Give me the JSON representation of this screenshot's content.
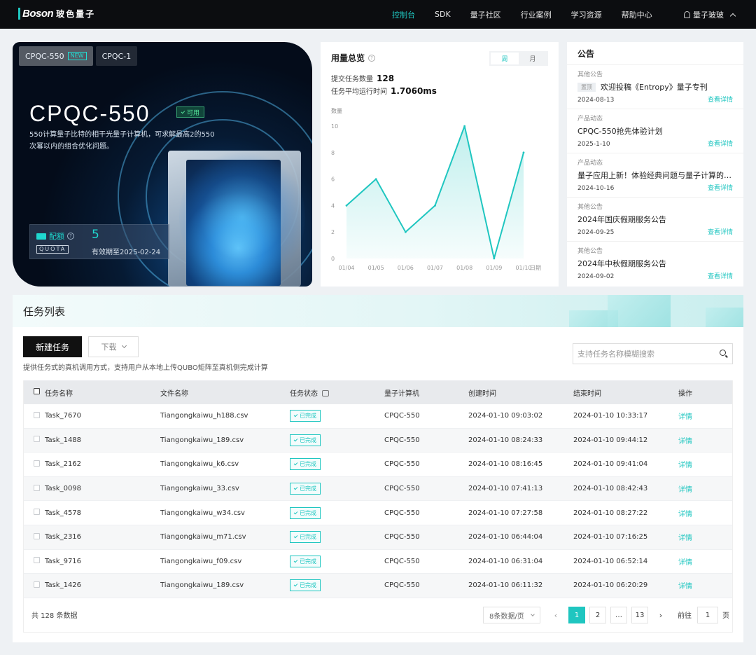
{
  "nav": {
    "logo_mark": "Boson",
    "logo_cn": "玻色量子",
    "items": [
      "控制台",
      "SDK",
      "量子社区",
      "行业案例",
      "学习资源",
      "帮助中心"
    ],
    "user": "量子玻玻"
  },
  "hero": {
    "tabs": [
      "CPQC-550",
      "CPQC-1"
    ],
    "new_tag": "NEW",
    "title": "CPQC-550",
    "badge": "可用",
    "desc": "550计算量子比特的相干光量子计算机，可求解最高2的550次幂以内的组合优化问题。",
    "quota_label": "配额",
    "quota_sub": "QUOTA",
    "quota_value": "5",
    "quota_expire": "有效期至2025-02-24"
  },
  "usage": {
    "title": "用量总览",
    "toggle": [
      "周",
      "月"
    ],
    "submit_label": "提交任务数量",
    "submit_value": "128",
    "avg_label": "任务平均运行时间",
    "avg_value": "1.7060ms"
  },
  "chart_data": {
    "type": "area",
    "title": "",
    "ylabel": "数量",
    "xlabel": "日期",
    "categories": [
      "01/04",
      "01/05",
      "01/06",
      "01/07",
      "01/08",
      "01/09",
      "01/10"
    ],
    "values": [
      4,
      6,
      2,
      4,
      10,
      0,
      8
    ],
    "yticks": [
      "0",
      "2",
      "4",
      "6",
      "8",
      "10"
    ],
    "ylim": [
      0,
      10
    ],
    "grid": false,
    "color": "#1fc6c0"
  },
  "notice": {
    "title": "公告",
    "pin_tag": "置顶",
    "link_label": "查看详情",
    "items": [
      {
        "category": "其他公告",
        "title": "欢迎投稿《Entropy》量子专刊",
        "date": "2024-08-13"
      },
      {
        "category": "产品动态",
        "title": "CPQC-550抢先体验计划",
        "date": "2025-1-10"
      },
      {
        "category": "产品动态",
        "title": "量子应用上新！体验经典问题与量子计算的…",
        "date": "2024-10-16"
      },
      {
        "category": "其他公告",
        "title": "2024年国庆假期服务公告",
        "date": "2024-09-25"
      },
      {
        "category": "其他公告",
        "title": "2024年中秋假期服务公告",
        "date": "2024-09-02"
      }
    ]
  },
  "tasks": {
    "title": "任务列表",
    "new_button": "新建任务",
    "download_button": "下载",
    "hint": "提供任务式的真机调用方式，支持用户从本地上传QUBO矩阵至真机侧完成计算",
    "search_placeholder": "支持任务名称模糊搜索",
    "columns": [
      "任务名称",
      "文件名称",
      "任务状态",
      "量子计算机",
      "创建时间",
      "结束时间",
      "操作"
    ],
    "status_label": "已完成",
    "action_label": "详情",
    "rows": [
      {
        "name": "Task_7670",
        "file": "Tiangongkaiwu_h188.csv",
        "machine": "CPQC-550",
        "created": "2024-01-10 09:03:02",
        "ended": "2024-01-10 10:33:17"
      },
      {
        "name": "Task_1488",
        "file": "Tiangongkaiwu_189.csv",
        "machine": "CPQC-550",
        "created": "2024-01-10 08:24:33",
        "ended": "2024-01-10 09:44:12"
      },
      {
        "name": "Task_2162",
        "file": "Tiangongkaiwu_k6.csv",
        "machine": "CPQC-550",
        "created": "2024-01-10 08:16:45",
        "ended": "2024-01-10 09:41:04"
      },
      {
        "name": "Task_0098",
        "file": "Tiangongkaiwu_33.csv",
        "machine": "CPQC-550",
        "created": "2024-01-10 07:41:13",
        "ended": "2024-01-10 08:42:43"
      },
      {
        "name": "Task_4578",
        "file": "Tiangongkaiwu_w34.csv",
        "machine": "CPQC-550",
        "created": "2024-01-10 07:27:58",
        "ended": "2024-01-10 08:27:22"
      },
      {
        "name": "Task_2316",
        "file": "Tiangongkaiwu_m71.csv",
        "machine": "CPQC-550",
        "created": "2024-01-10 06:44:04",
        "ended": "2024-01-10 07:16:25"
      },
      {
        "name": "Task_9716",
        "file": "Tiangongkaiwu_f09.csv",
        "machine": "CPQC-550",
        "created": "2024-01-10 06:31:04",
        "ended": "2024-01-10 06:52:14"
      },
      {
        "name": "Task_1426",
        "file": "Tiangongkaiwu_189.csv",
        "machine": "CPQC-550",
        "created": "2024-01-10 06:11:32",
        "ended": "2024-01-10 06:20:29"
      }
    ],
    "pager": {
      "total": "共 128 条数据",
      "page_size": "8条数据/页",
      "pages": [
        "1",
        "2",
        "…",
        "13"
      ],
      "prev": "‹",
      "next": "›",
      "goto_label": "前往",
      "goto_value": "1",
      "goto_unit": "页"
    }
  },
  "colors": {
    "accent": "#1fc6c0",
    "nav_bg": "#0c0d10"
  }
}
